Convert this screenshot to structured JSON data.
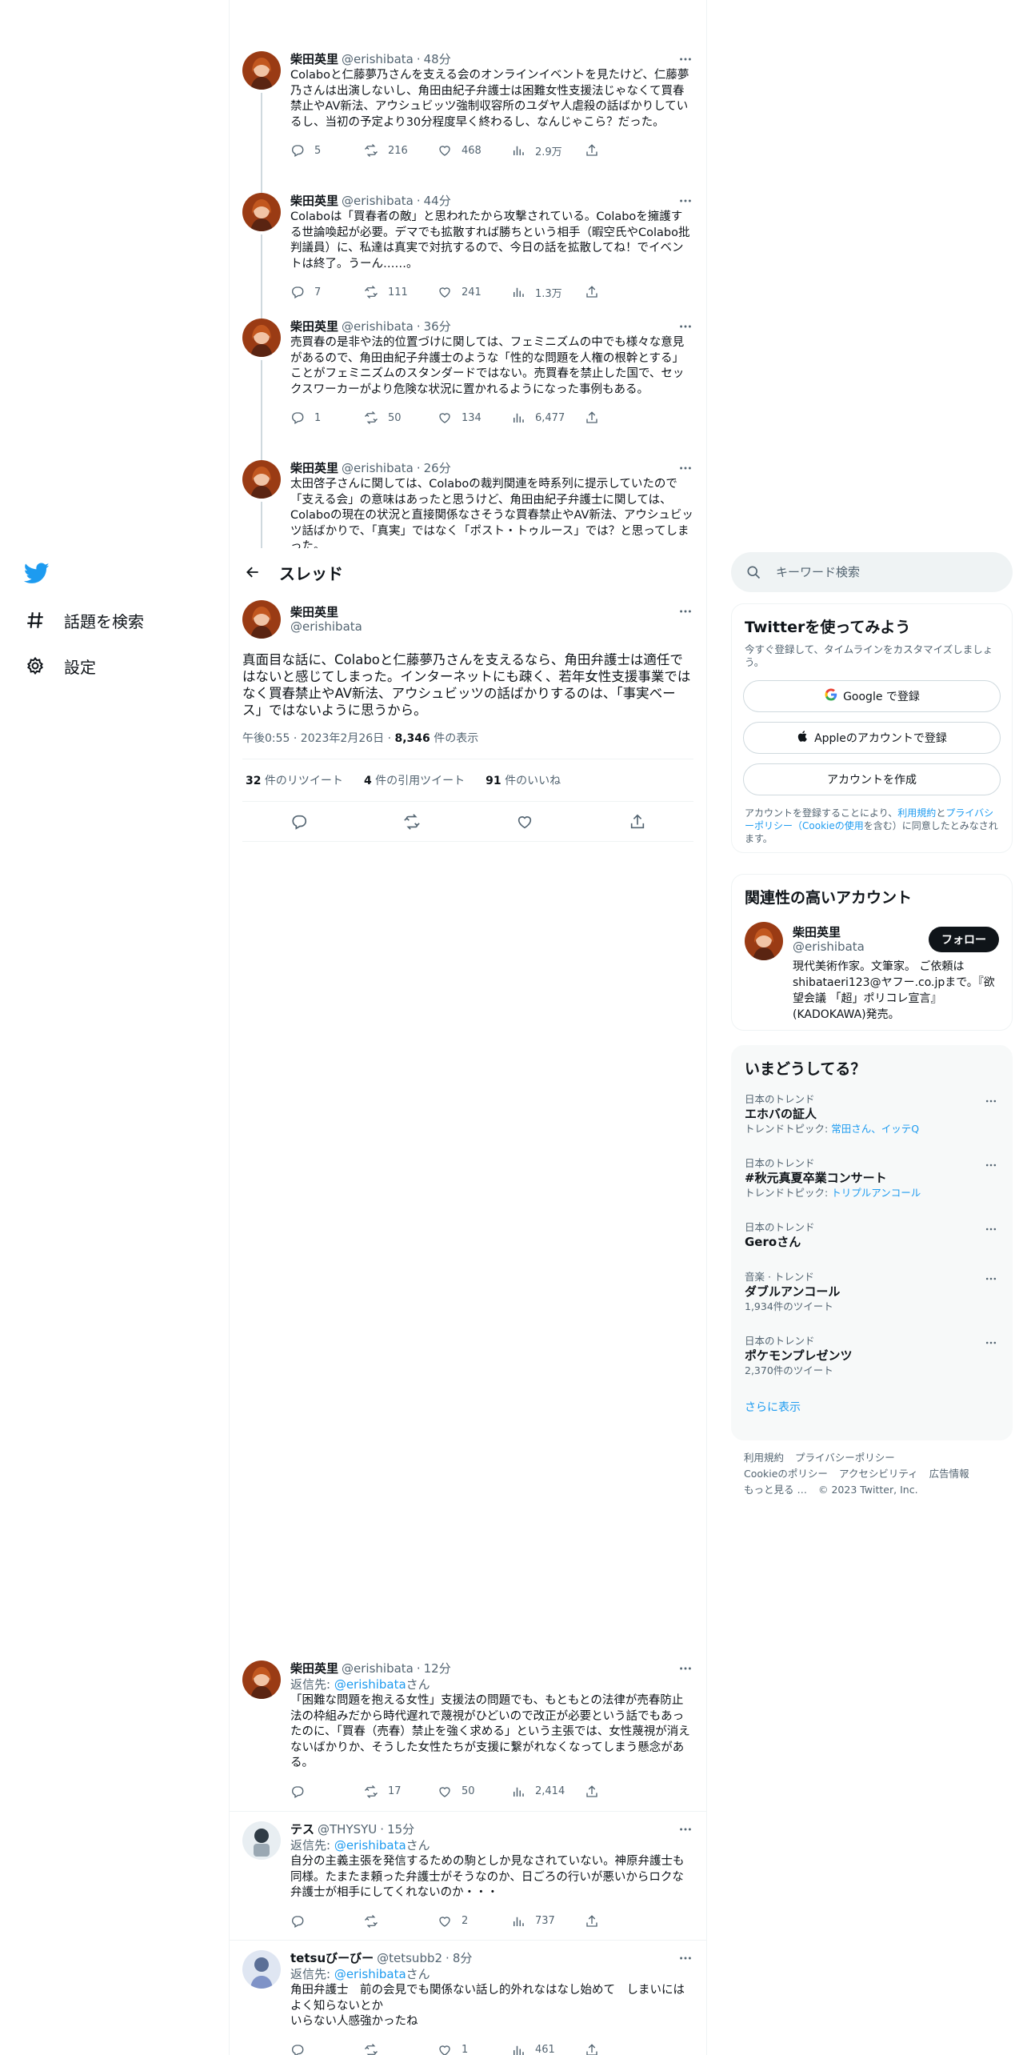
{
  "nav": {
    "explore_label": "話題を検索",
    "settings_label": "設定"
  },
  "thread_header": {
    "title": "スレッド"
  },
  "above_tweets": [
    {
      "name": "柴田英里",
      "handle": "@erishibata",
      "time": "48分",
      "text": "Colaboと仁藤夢乃さんを支える会のオンラインイベントを見たけど、仁藤夢乃さんは出演しないし、角田由紀子弁護士は困難女性支援法じゃなくて買春禁止やAV新法、アウシュビッツ強制収容所のユダヤ人虐殺の話ばかりしているし、当初の予定より30分程度早く終わるし、なんじゃこら？だった。",
      "replies": "5",
      "retweets": "216",
      "likes": "468",
      "views": "2.9万"
    },
    {
      "name": "柴田英里",
      "handle": "@erishibata",
      "time": "44分",
      "text": "Colaboは「買春者の敵」と思われたから攻撃されている。Colaboを擁護する世論喚起が必要。デマでも拡散すれば勝ちという相手（暇空氏やColabo批判議員）に、私達は真実で対抗するので、今日の話を拡散してね！でイベントは終了。うーん……。",
      "replies": "7",
      "retweets": "111",
      "likes": "241",
      "views": "1.3万"
    },
    {
      "name": "柴田英里",
      "handle": "@erishibata",
      "time": "36分",
      "text": "売買春の是非や法的位置づけに関しては、フェミニズムの中でも様々な意見があるので、角田由紀子弁護士のような「性的な問題を人権の根幹とする」ことがフェミニズムのスタンダードではない。売買春を禁止した国で、セックスワーカーがより危険な状況に置かれるようになった事例もある。",
      "replies": "1",
      "retweets": "50",
      "likes": "134",
      "views": "6,477"
    },
    {
      "name": "柴田英里",
      "handle": "@erishibata",
      "time": "26分",
      "text": "太田啓子さんに関しては、Colaboの裁判関連を時系列に提示していたので「支える会」の意味はあったと思うけど、角田由紀子弁護士に関しては、Colaboの現在の状況と直接関係なさそうな買春禁止やAV新法、アウシュビッツ話ばかりで、「真実」ではなく「ポスト・トゥルース」では？と思ってしまった。"
    }
  ],
  "focus_tweet": {
    "name": "柴田英里",
    "handle": "@erishibata",
    "text": "真面目な話に、Colaboと仁藤夢乃さんを支えるなら、角田弁護士は適任ではないと感じてしまった。インターネットにも疎く、若年女性支援事業ではなく買春禁止やAV新法、アウシュビッツの話ばかりするのは、「事実ベース」ではないように思うから。",
    "time": "午後0:55 · 2023年2月26日 · ",
    "views_num": "8,346",
    "views_label": " 件の表示",
    "retweets_num": "32",
    "retweets_label": " 件のリツイート",
    "quotes_num": "4",
    "quotes_label": " 件の引用ツイート",
    "likes_num": "91",
    "likes_label": " 件のいいね"
  },
  "reply_tweets": [
    {
      "name": "柴田英里",
      "handle": "@erishibata",
      "time": "12分",
      "reply_prefix": "返信先: ",
      "reply_mention": "@erishibata",
      "reply_suffix": "さん",
      "text": "「困難な問題を抱える女性」支援法の問題でも、もともとの法律が売春防止法の枠組みだから時代遅れで蔑視がひどいので改正が必要という話でもあったのに、「買春（売春）禁止を強く求める」という主張では、女性蔑視が消えないばかりか、そうした女性たちが支援に繋がれなくなってしまう懸念がある。",
      "replies": "",
      "retweets": "17",
      "likes": "50",
      "views": "2,414"
    },
    {
      "name": "テス",
      "handle": "@THYSYU",
      "time": "15分",
      "reply_prefix": "返信先: ",
      "reply_mention": "@erishibata",
      "reply_suffix": "さん",
      "text": "自分の主義主張を発信するための駒としか見なされていない。神原弁護士も同様。たまたま頼った弁護士がそうなのか、日ごろの行いが悪いからロクな弁護士が相手にしてくれないのか・・・",
      "replies": "",
      "retweets": "",
      "likes": "2",
      "views": "737"
    },
    {
      "name": "tetsuびーびー",
      "handle": "@tetsubb2",
      "time": "8分",
      "reply_prefix": "返信先: ",
      "reply_mention": "@erishibata",
      "reply_suffix": "さん",
      "text": "角田弁護士　前の会見でも関係ない話し的外れなはなし始めて　しまいにはよく知らないとか\nいらない人感強かったね",
      "replies": "",
      "retweets": "",
      "likes": "1",
      "views": "461"
    }
  ],
  "search": {
    "placeholder": "キーワード検索"
  },
  "signup": {
    "title": "Twitterを使ってみよう",
    "subtitle": "今すぐ登録して、タイムラインをカスタマイズしましょう。",
    "google_btn": "Google で登録",
    "apple_btn": "Appleのアカウントで登録",
    "create_btn": "アカウントを作成",
    "legal_1": "アカウントを登録することにより、",
    "legal_terms": "利用規約",
    "legal_2": "と",
    "legal_privacy": "プライバシーポリシー（Cookieの使用",
    "legal_3": "を含む）に同意したとみなされます。"
  },
  "who": {
    "title": "関連性の高いアカウント",
    "name": "柴田英里",
    "handle": "@erishibata",
    "follow": "フォロー",
    "bio": "現代美術作家。文筆家。 ご依頼はshibataeri123@ヤフー.co.jpまで。『欲望会議 「超」ポリコレ宣言』(KADOKAWA)発売。"
  },
  "trends": {
    "title": "いまどうしてる？",
    "items": [
      {
        "ctx": "日本のトレンド",
        "name": "エホバの証人",
        "sub_prefix": "トレンドトピック: ",
        "sub_link": "常田さん、イッテQ",
        "sub": ""
      },
      {
        "ctx": "日本のトレンド",
        "name": "#秋元真夏卒業コンサート",
        "sub_prefix": "トレンドトピック: ",
        "sub_link": "トリプルアンコール",
        "sub": ""
      },
      {
        "ctx": "日本のトレンド",
        "name": "Geroさん",
        "sub_prefix": "",
        "sub_link": "",
        "sub": ""
      },
      {
        "ctx": "音楽 · トレンド",
        "name": "ダブルアンコール",
        "sub_prefix": "",
        "sub_link": "",
        "sub": "1,934件のツイート"
      },
      {
        "ctx": "日本のトレンド",
        "name": "ポケモンプレゼンツ",
        "sub_prefix": "",
        "sub_link": "",
        "sub": "2,370件のツイート"
      }
    ],
    "show_more": "さらに表示"
  },
  "footer": {
    "terms": "利用規約",
    "privacy": "プライバシーポリシー",
    "cookie": "Cookieのポリシー",
    "accessibility": "アクセシビリティ",
    "ads": "広告情報",
    "more": "もっと見る …",
    "copyright": "© 2023 Twitter, Inc."
  },
  "colors": {
    "accent": "#1d9bf0",
    "text": "#0f1419",
    "muted": "#536471",
    "border": "#eff3f4"
  }
}
